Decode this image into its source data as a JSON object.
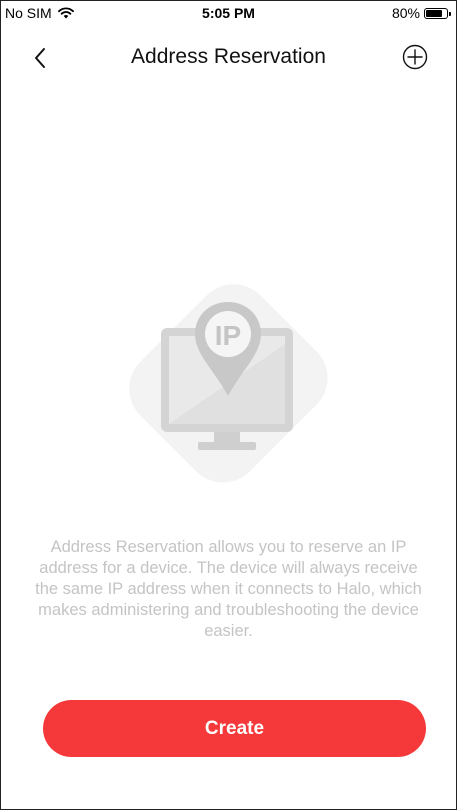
{
  "status_bar": {
    "carrier": "No SIM",
    "time": "5:05 PM",
    "battery_percent": "80%",
    "battery_level": 0.8,
    "wifi_icon": "wifi-icon"
  },
  "nav": {
    "title": "Address Reservation",
    "back_icon": "chevron-left-icon",
    "add_icon": "plus-circle-icon"
  },
  "illustration": {
    "badge_text": "IP",
    "icon": "monitor-location-pin-icon"
  },
  "description": "Address Reservation allows you to reserve an IP address for a device. The device will always receive the same IP address when it connects to Halo, which makes administering and troubleshooting the device easier.",
  "create_button": {
    "label": "Create",
    "color": "#f5393a"
  }
}
